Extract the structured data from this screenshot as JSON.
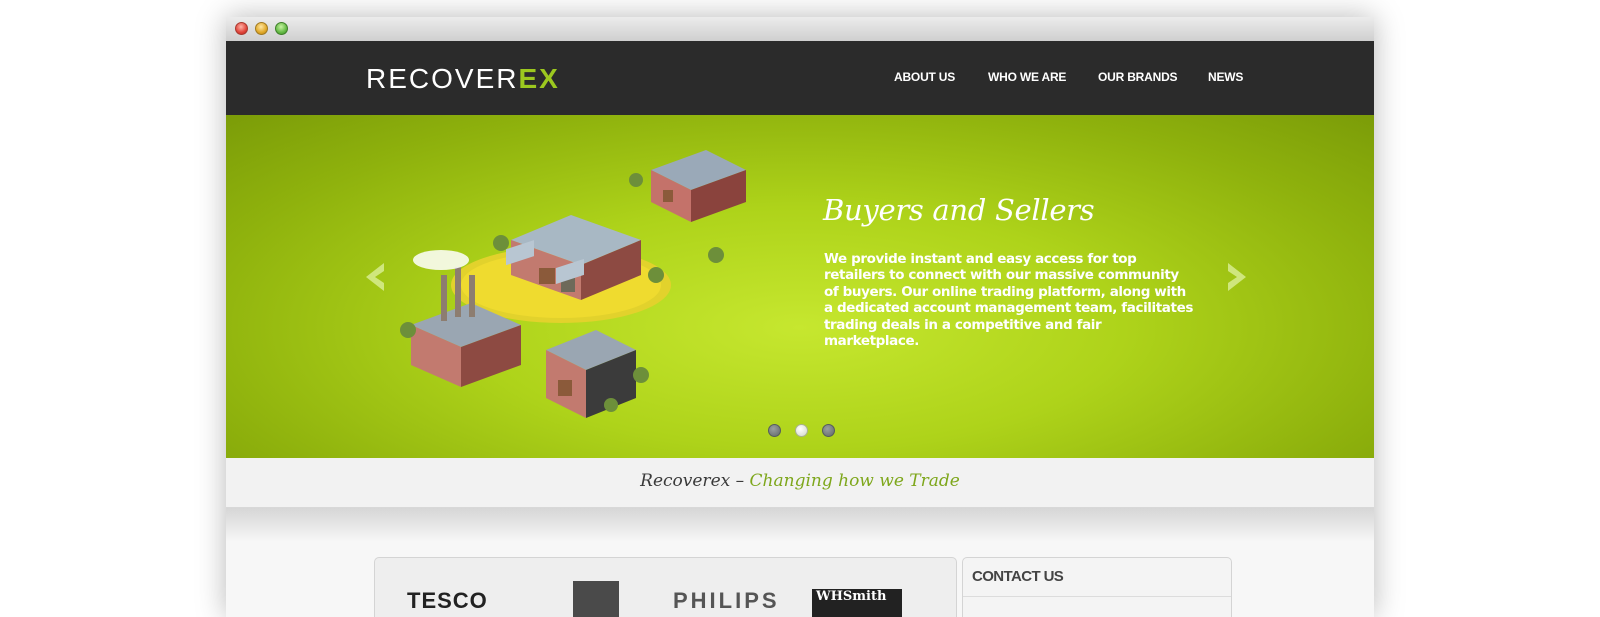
{
  "window": {
    "controls": [
      "close",
      "minimize",
      "zoom"
    ]
  },
  "header": {
    "logo_primary": "RECOVER",
    "logo_accent": "EX",
    "nav": [
      {
        "label": "ABOUT US"
      },
      {
        "label": "WHO WE ARE"
      },
      {
        "label": "OUR BRANDS"
      },
      {
        "label": "NEWS"
      }
    ]
  },
  "hero": {
    "title": "Buyers and Sellers",
    "body": "We provide instant and easy access for top retailers to connect with our massive community of buyers. Our online trading platform, along with a dedicated account management team, facilitates trading deals in a competitive and fair marketplace.",
    "slide_count": 3,
    "active_slide": 2,
    "prev_icon": "chevron-left-icon",
    "next_icon": "chevron-right-icon",
    "illustration": "isometric-factories-illustration"
  },
  "tagline": {
    "brand": "Recoverex –",
    "slogan": "Changing how we Trade"
  },
  "brands": {
    "tesco": "TESCO",
    "philips": "PHILIPS",
    "whsmith": "WHSmith"
  },
  "contact": {
    "title": "CONTACT US"
  },
  "colors": {
    "accent": "#9cc81f",
    "nav_bg": "#2b2b2b",
    "hero_green": "#aed31a",
    "tagline_accent": "#7ea71c"
  }
}
